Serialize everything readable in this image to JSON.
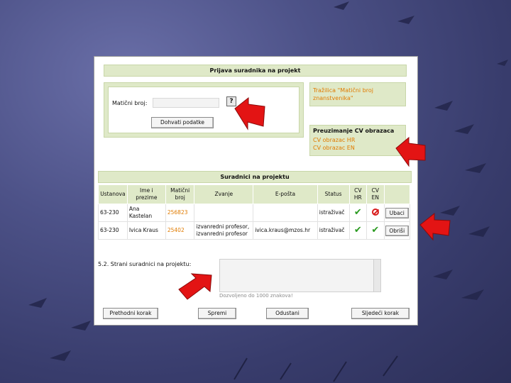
{
  "form": {
    "title": "Prijava suradnika na projekt",
    "maticni_label": "Matični broj:",
    "maticni_value": "",
    "help_symbol": "?",
    "fetch_button": "Dohvati podatke"
  },
  "search_panel": {
    "text": "Tražilica \"Matični broj znanstvenika\""
  },
  "cv_panel": {
    "title": "Preuzimanje CV obrazaca",
    "link_hr": "CV obrazac HR",
    "link_en": "CV obrazac EN"
  },
  "collaborators": {
    "title": "Suradnici na projektu",
    "headers": [
      "Ustanova",
      "Ime i prezime",
      "Matični broj",
      "Zvanje",
      "E-pošta",
      "Status",
      "CV HR",
      "CV EN",
      ""
    ],
    "rows": [
      {
        "ustanova": "63-230",
        "ime": "Ana Kastelan",
        "maticni": "256823",
        "zvanje": "",
        "email": "",
        "status": "istraživač",
        "cv_hr": "check",
        "cv_en": "missing",
        "action": "Ubaci"
      },
      {
        "ustanova": "63-230",
        "ime": "Ivica Kraus",
        "maticni": "25402",
        "zvanje": "izvanredni profesor, izvanredni profesor",
        "email": "ivica.kraus@mzos.hr",
        "status": "istraživač",
        "cv_hr": "check",
        "cv_en": "check",
        "action": "Obriši"
      }
    ]
  },
  "foreign": {
    "label": "5.2. Strani suradnici na projektu:",
    "value": "",
    "hint": "Dozvoljeno do 1000 znakova!"
  },
  "nav": {
    "prev": "Prethodni korak",
    "save": "Spremi",
    "cancel": "Odustani",
    "next": "Sljedeći korak"
  },
  "colors": {
    "panel_green": "#dfe9c8",
    "link_orange": "#e07b00",
    "arrow_red": "#e31414",
    "background": "#3d4173"
  }
}
